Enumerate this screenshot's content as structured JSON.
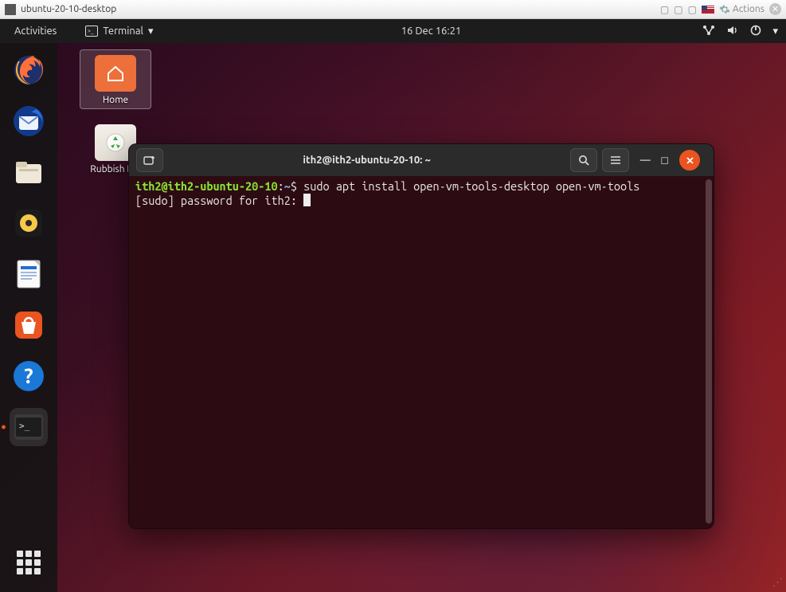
{
  "vm_chrome": {
    "title": "ubuntu-20-10-desktop",
    "actions_label": "Actions"
  },
  "topbar": {
    "activities": "Activities",
    "app_label": "Terminal",
    "clock": "16 Dec  16:21"
  },
  "dock": {
    "items": [
      {
        "name": "firefox",
        "color": "#ff7139"
      },
      {
        "name": "thunderbird",
        "color": "#1f6fd0"
      },
      {
        "name": "files",
        "color": "#efe7d7"
      },
      {
        "name": "rhythmbox",
        "color": "#f7c948"
      },
      {
        "name": "libreoffice-writer",
        "color": "#1f6fd0"
      },
      {
        "name": "software",
        "color": "#e95420"
      },
      {
        "name": "help",
        "color": "#1a78d6"
      },
      {
        "name": "terminal",
        "color": "#2d2d2d",
        "active": true
      }
    ],
    "show_apps_label": "Show Applications"
  },
  "desktop_icons": {
    "home": {
      "label": "Home"
    },
    "trash": {
      "label": "Rubbish Bin"
    }
  },
  "terminal": {
    "window_title": "ith2@ith2-ubuntu-20-10: ~",
    "prompt": {
      "user_host": "ith2@ith2-ubuntu-20-10",
      "path": "~",
      "symbol": "$"
    },
    "command": "sudo apt install open-vm-tools-desktop open-vm-tools",
    "line2": "[sudo] password for ith2: "
  }
}
